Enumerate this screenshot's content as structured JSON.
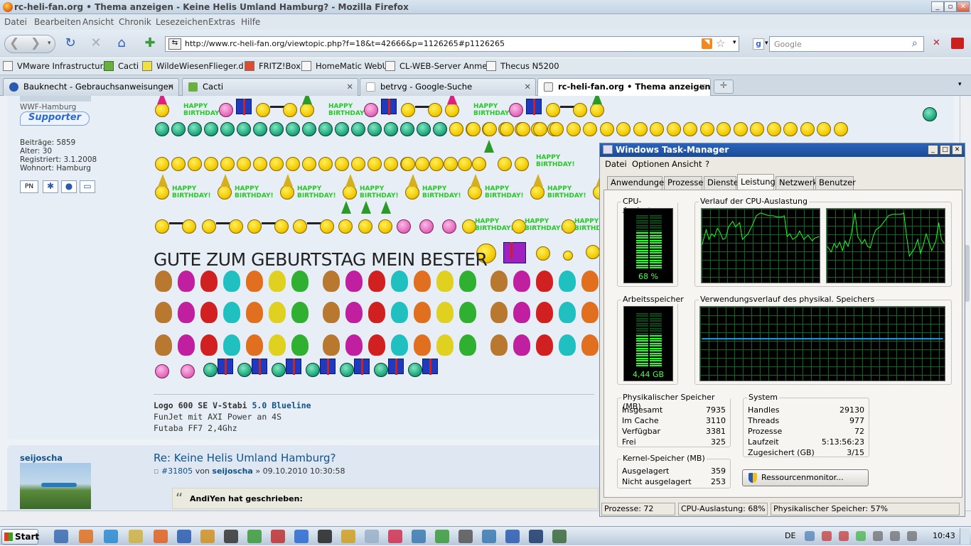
{
  "browser": {
    "title": "rc-heli-fan.org • Thema anzeigen - Keine Helis Umland Hamburg? - Mozilla Firefox",
    "menu": [
      "Datei",
      "Bearbeiten",
      "Ansicht",
      "Chronik",
      "Lesezeichen",
      "Extras",
      "Hilfe"
    ],
    "url": "http://www.rc-heli-fan.org/viewtopic.php?f=18&t=42666&p=1126265#p1126265",
    "search_placeholder": "Google",
    "bookmarks": [
      "VMware Infrastructur...",
      "Cacti",
      "WildeWiesenFlieger.d...",
      "FRITZ!Box",
      "HomeMatic WebUI",
      "CL-WEB-Server Anme...",
      "Thecus N5200"
    ],
    "tabs": [
      {
        "label": "Bauknecht - Gebrauchsanweisungen",
        "active": false
      },
      {
        "label": "Cacti",
        "active": false
      },
      {
        "label": "betrvg - Google-Suche",
        "active": false
      },
      {
        "label": "rc-heli-fan.org • Thema anzeigen...",
        "active": true
      }
    ]
  },
  "post1": {
    "group": "WWF-Hamburg",
    "rank": "Supporter",
    "profile": [
      {
        "label": "Beiträge:",
        "value": "5859"
      },
      {
        "label": "Alter:",
        "value": "30"
      },
      {
        "label": "Registriert:",
        "value": "3.1.2008"
      },
      {
        "label": "Wohnort:",
        "value": "Hamburg"
      }
    ],
    "happy_birthday": "HAPPY BIRTHDAY!",
    "headline": "GUTE ZUM GEBURTSTAG MEIN BESTER",
    "signature": {
      "line1_prefix": "Logo 600 SE V-Stabi",
      "line1_accent": "5.0 Blueline",
      "line2": "FunJet mit AXI Power an 4S",
      "line3": "Futaba FF7 2,4Ghz"
    }
  },
  "post2": {
    "author": "seijoscha",
    "title": "Re: Keine Helis Umland Hamburg?",
    "post_number": "#31805",
    "by_text": "von",
    "author_link": "seijoscha",
    "date": "» 09.10.2010 10:30:58",
    "quote_header": "AndiYen hat geschrieben:"
  },
  "taskmanager": {
    "title": "Windows Task-Manager",
    "menu": [
      "Datei",
      "Optionen",
      "Ansicht",
      "?"
    ],
    "tabs": [
      "Anwendungen",
      "Prozesse",
      "Dienste",
      "Leistung",
      "Netzwerk",
      "Benutzer"
    ],
    "active_tab": "Leistung",
    "cpu_label": "CPU-Auslastung",
    "cpu_value": "68 %",
    "cpu_fraction": 0.68,
    "cpu_history_label": "Verlauf der CPU-Auslastung",
    "mem_label": "Arbeitsspeicher",
    "mem_value": "4,44 GB",
    "mem_fraction": 0.57,
    "mem_history_label": "Verwendungsverlauf des physikal. Speichers",
    "phys": {
      "title": "Physikalischer Speicher (MB)",
      "rows": [
        {
          "label": "Insgesamt",
          "value": "7935"
        },
        {
          "label": "Im Cache",
          "value": "3110"
        },
        {
          "label": "Verfügbar",
          "value": "3381"
        },
        {
          "label": "Frei",
          "value": "325"
        }
      ]
    },
    "system": {
      "title": "System",
      "rows": [
        {
          "label": "Handles",
          "value": "29130"
        },
        {
          "label": "Threads",
          "value": "977"
        },
        {
          "label": "Prozesse",
          "value": "72"
        },
        {
          "label": "Laufzeit",
          "value": "5:13:56:23"
        },
        {
          "label": "Zugesichert (GB)",
          "value": "3/15"
        }
      ]
    },
    "kernel": {
      "title": "Kernel-Speicher (MB)",
      "rows": [
        {
          "label": "Ausgelagert",
          "value": "359"
        },
        {
          "label": "Nicht ausgelagert",
          "value": "253"
        }
      ]
    },
    "resmon_button": "Ressourcenmonitor...",
    "status": [
      "Prozesse: 72",
      "CPU-Auslastung: 68%",
      "Physikalischer Speicher: 57%"
    ]
  },
  "taskbar": {
    "start": "Start",
    "lang": "DE",
    "clock": "10:43"
  },
  "colors": {
    "graph_green": "#22ff22",
    "mem_line": "#2a9ae0",
    "link_blue": "#105289",
    "titlebar_blue": "#1b4b98"
  }
}
